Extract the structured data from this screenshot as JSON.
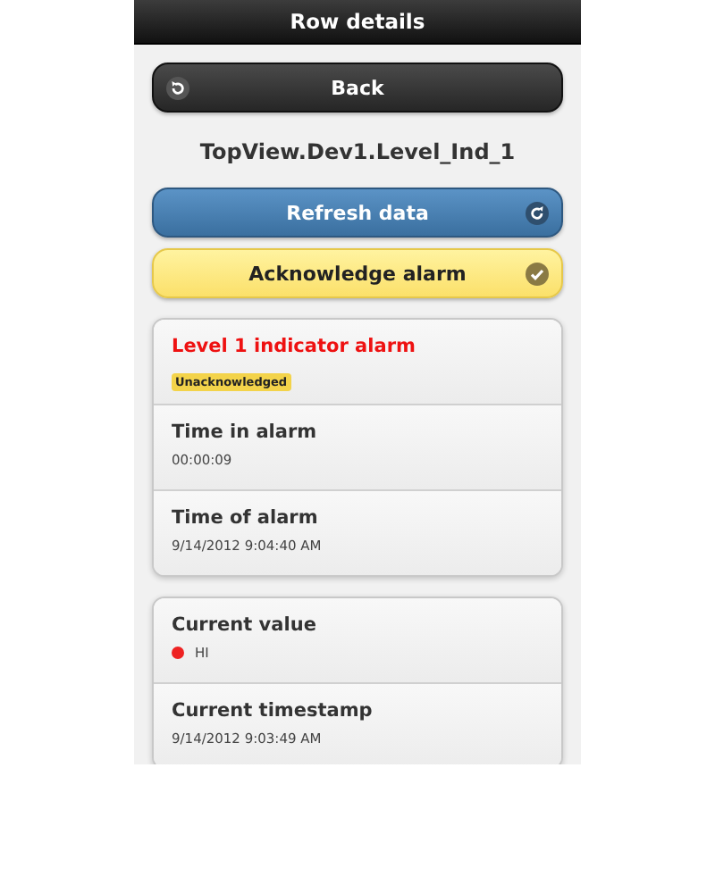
{
  "header": {
    "title": "Row details"
  },
  "back_button": {
    "label": "Back"
  },
  "item_name": "TopView.Dev1.Level_Ind_1",
  "actions": [
    {
      "label": "Refresh data",
      "kind": "refresh"
    },
    {
      "label": "Acknowledge alarm",
      "kind": "acknowledge"
    }
  ],
  "cards": [
    {
      "rows": [
        {
          "kind": "alarm",
          "title": "Level 1 indicator alarm",
          "badge": "Unacknowledged"
        },
        {
          "kind": "field",
          "title": "Time in alarm",
          "value": "00:00:09"
        },
        {
          "kind": "field",
          "title": "Time of alarm",
          "value": "9/14/2012 9:04:40 AM"
        }
      ]
    },
    {
      "rows": [
        {
          "kind": "status",
          "title": "Current value",
          "value": "HI",
          "color": "#ee2222"
        },
        {
          "kind": "field",
          "title": "Current timestamp",
          "value": "9/14/2012 9:03:49 AM"
        }
      ]
    }
  ]
}
